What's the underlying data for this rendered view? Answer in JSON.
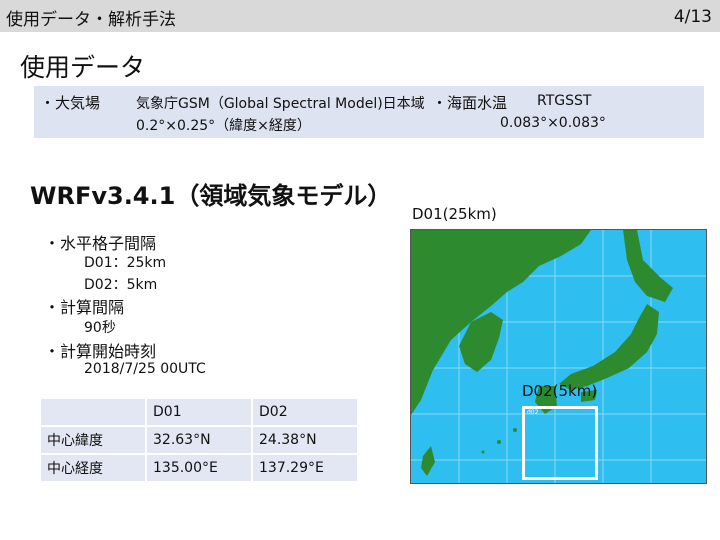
{
  "header": {
    "title": "使用データ・解析手法",
    "page": "4/13"
  },
  "section_title": "使用データ",
  "atmosphere": {
    "label": "・大気場",
    "source": "気象庁GSM（Global Spectral Model)日本域",
    "resolution": "0.2°×0.25°（緯度×経度）"
  },
  "sst": {
    "label": "・海面水温",
    "source": "RTGSST",
    "resolution": "0.083°×0.083°"
  },
  "model_title": "WRFv3.4.1（領域気象モデル）",
  "settings": {
    "grid_label": "・水平格子間隔",
    "grid_d01": "D01：25km",
    "grid_d02": "D02：5km",
    "step_label": "・計算間隔",
    "step_value": "90秒",
    "start_label": "・計算開始時刻",
    "start_value": "2018/7/25 00UTC"
  },
  "domain_table": {
    "headers": [
      "",
      "D01",
      "D02"
    ],
    "rows": [
      [
        "中心緯度",
        "32.63°N",
        "24.38°N"
      ],
      [
        "中心経度",
        "135.00°E",
        "137.29°E"
      ]
    ]
  },
  "map": {
    "d01_label": "D01(25km)",
    "d02_label": "D02(5km)",
    "d02_tag": "d02",
    "colors": {
      "sea": "#2ebff0",
      "land": "#2e8a2e",
      "grid": "#8fd7f0",
      "box": "#ffffff"
    }
  }
}
